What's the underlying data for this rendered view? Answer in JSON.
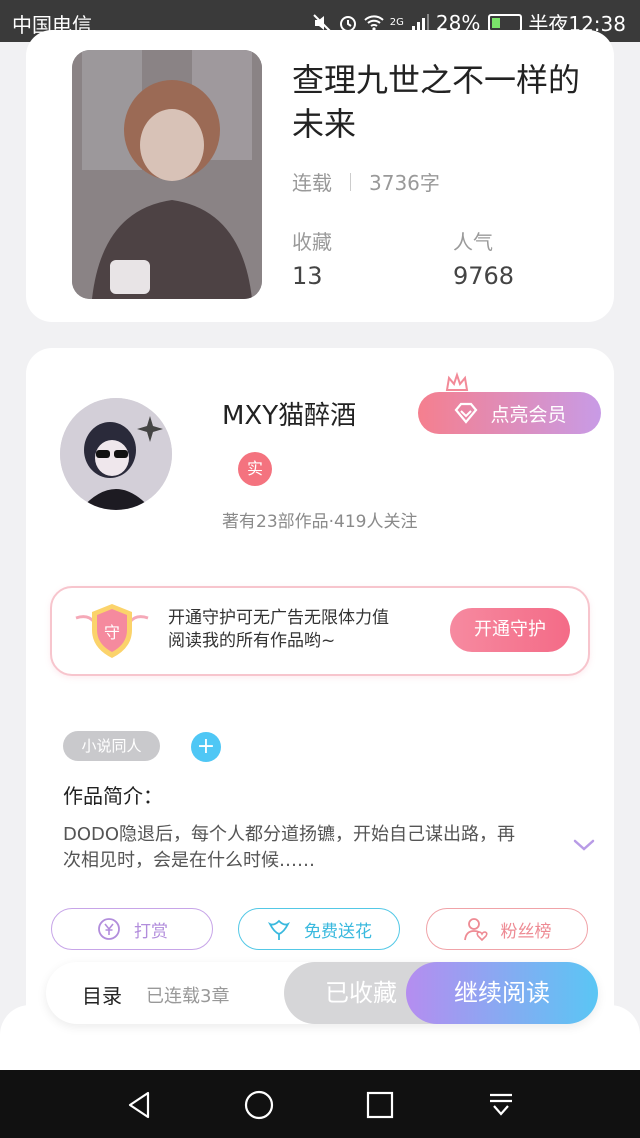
{
  "status_bar": {
    "carrier": "中国电信",
    "network": "2G",
    "battery": "28%",
    "time": "半夜12:38"
  },
  "book": {
    "title": "查理九世之不一样的未来",
    "status": "连载",
    "word_count": "3736字",
    "favorites_label": "收藏",
    "favorites_value": "13",
    "popularity_label": "人气",
    "popularity_value": "9768"
  },
  "author": {
    "name": "MXY猫醉酒",
    "real_badge": "实",
    "stats": "著有23部作品·419人关注",
    "vip_button": "点亮会员"
  },
  "guard": {
    "shield_char": "守",
    "text_line1": "开通守护可无广告无限体力值",
    "text_line2": "阅读我的所有作品哟~",
    "button": "开通守护"
  },
  "tags": {
    "items": [
      "小说同人"
    ],
    "add": "+"
  },
  "intro": {
    "label": "作品简介：",
    "text": "DODO隐退后，每个人都分道扬镳，开始自己谋出路，再次相见时，会是在什么时候……"
  },
  "actions": {
    "tip": "打赏",
    "flower": "免费送花",
    "fans": "粉丝榜"
  },
  "bottom_bar": {
    "catalog": "目录",
    "serial_count": "已连载3章",
    "collected": "已收藏",
    "continue_read": "继续阅读"
  },
  "colors": {
    "vip_gradient_start": "#f57f8e",
    "vip_gradient_end": "#c89be6",
    "read_gradient_start": "#b58df0",
    "read_gradient_end": "#5ac6f4",
    "guard_button": "#f46b87"
  }
}
